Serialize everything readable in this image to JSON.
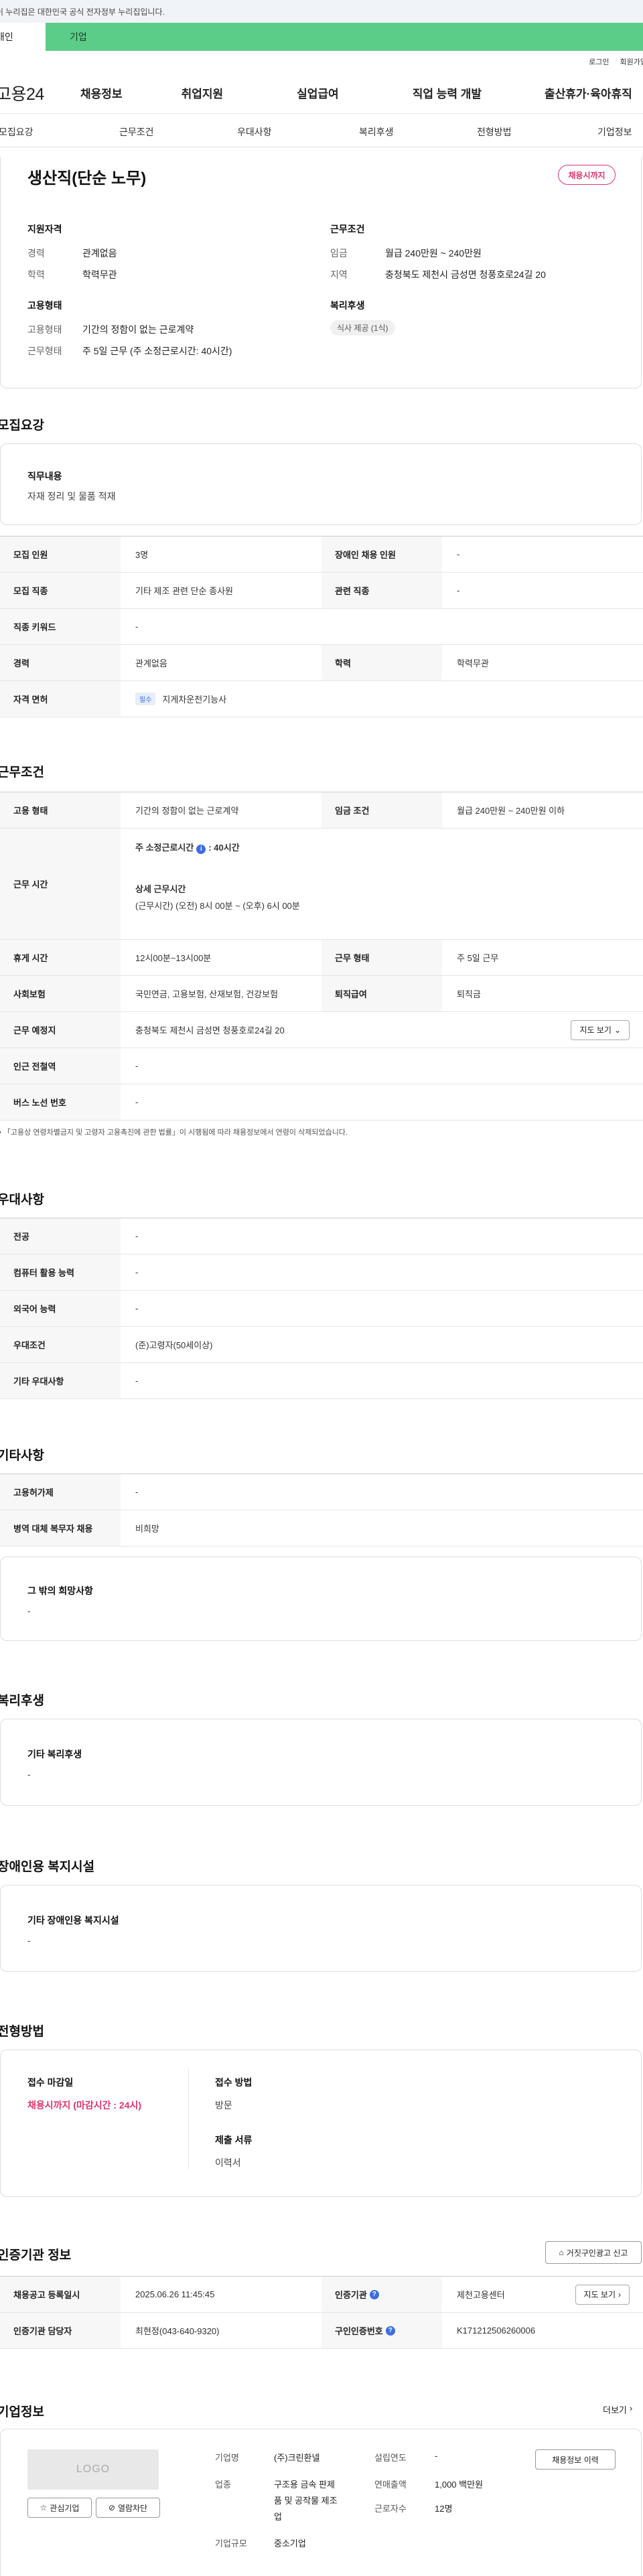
{
  "gov_banner": "이 누리집은 대한민국 공식 전자정부 누리집입니다.",
  "user_tabs": {
    "personal": "개인",
    "company": "기업"
  },
  "util": {
    "login": "로그인",
    "join": "회원가입"
  },
  "logo": "고용24",
  "gnb": [
    "채용정보",
    "취업지원",
    "실업급여",
    "직업 능력 개발",
    "출산휴가·육아휴직"
  ],
  "anchor_tabs": [
    "모집요강",
    "근무조건",
    "우대사항",
    "복리후생",
    "전형방법",
    "기업정보"
  ],
  "summary": {
    "title": "생산직(단순 노무)",
    "badge": "채용시까지",
    "qual_head": "지원자격",
    "career_k": "경력",
    "career_v": "관계없음",
    "edu_k": "학력",
    "edu_v": "학력무관",
    "emp_head": "고용형태",
    "emp_k": "고용형태",
    "emp_v": "기간의 정함이 없는 근로계약",
    "work_k": "근무형태",
    "work_v": "주 5일 근무 (주 소정근로시간: 40시간)",
    "cond_head": "근무조건",
    "wage_k": "임금",
    "wage_v": "월급 240만원 ~ 240만원",
    "region_k": "지역",
    "region_v": "충청북도 제천시 금성면 청풍호로24길 20",
    "welfare_head": "복리후생",
    "welfare_chip": "식사 제공 (1식)"
  },
  "recruit": {
    "title": "모집요강",
    "duty_head": "직무내용",
    "duty_v": "자재 정리 및 물품 적재",
    "rows": {
      "count_k": "모집 인원",
      "count_v": "3명",
      "disabled_k": "장애인 채용 인원",
      "disabled_v": "-",
      "job_k": "모집 직종",
      "job_v": "기타 제조 관련 단순 종사원",
      "related_k": "관련 직종",
      "related_v": "-",
      "keyword_k": "직종 키워드",
      "keyword_v": "-",
      "career_k": "경력",
      "career_v": "관계없음",
      "edu_k": "학력",
      "edu_v": "학력무관",
      "license_k": "자격 면허",
      "license_tag": "필수",
      "license_v": "지게차운전기능사"
    }
  },
  "conditions": {
    "title": "근무조건",
    "emp_k": "고용 형태",
    "emp_v": "기간의 정함이 없는 근로계약",
    "wage_k": "임금 조건",
    "wage_v": "월급 240만원 ~ 240만원 이하",
    "hours_k": "근무 시간",
    "hours_l1a": "주 소정근로시간",
    "hours_l1b": ": 40시간",
    "hours_l2": "상세 근무시간",
    "hours_l3": "(근무시간) (오전) 8시 00분 ~ (오후) 6시 00분",
    "break_k": "휴게 시간",
    "break_v": "12시00분~13시00분",
    "type_k": "근무 형태",
    "type_v": "주 5일 근무",
    "ins_k": "사회보험",
    "ins_v": "국민연금, 고용보험, 산재보험, 건강보험",
    "pension_k": "퇴직급여",
    "pension_v": "퇴직금",
    "place_k": "근무 예정지",
    "place_v": "충청북도 제천시 금성면 청풍호로24길 20",
    "map_btn": "지도 보기",
    "station_k": "인근 전철역",
    "station_v": "-",
    "bus_k": "버스 노선 번호",
    "bus_v": "-",
    "note": "「고용상 연령차별금지 및 고령자 고용촉진에 관한 법률」이 시행됨에 따라 채용정보에서 연령이 삭제되었습니다."
  },
  "preferred": {
    "title": "우대사항",
    "major_k": "전공",
    "major_v": "-",
    "pc_k": "컴퓨터 활용 능력",
    "pc_v": "-",
    "lang_k": "외국어 능력",
    "lang_v": "-",
    "cond_k": "우대조건",
    "cond_v": "(준)고령자(50세이상)",
    "etc_k": "기타 우대사항",
    "etc_v": "-"
  },
  "others": {
    "title": "기타사항",
    "equip_k": "고용허가제",
    "equip_v": "-",
    "military_k": "병역 대체 복무자 채용",
    "military_v": "비희망",
    "wish_head": "그 밖의 희망사항",
    "wish_v": "-"
  },
  "welfare": {
    "title": "복리후생",
    "head": "기타 복리후생",
    "v": "-"
  },
  "facility": {
    "title": "장애인용 복지시설",
    "head": "기타 장애인용 복지시설",
    "v": "-"
  },
  "selection": {
    "title": "전형방법",
    "deadline_head": "접수 마감일",
    "deadline_v": "채용시까지 (마감시간 : 24시)",
    "method_head": "접수 방법",
    "method_v": "방문",
    "docs_head": "제출 서류",
    "docs_v": "이력서"
  },
  "agency": {
    "title": "인증기관 정보",
    "report_btn": "거짓구인광고 신고",
    "reg_k": "채용공고 등록일시",
    "reg_v": "2025.06.26 11:45:45",
    "org_k": "인증기관",
    "org_v": "제천고용센터",
    "map_btn": "지도 보기",
    "mgr_k": "인증기관 담당자",
    "mgr_v": "최현정(043-640-9320)",
    "no_k": "구인인증번호",
    "no_v": "K171212506260006"
  },
  "company": {
    "title": "기업정보",
    "more": "더보기",
    "logo_text": "LOGO",
    "fav_btn": "관심기업",
    "block_btn": "열람차단",
    "name_k": "기업명",
    "name_v": "(주)크린환넬",
    "ind_k": "업종",
    "ind_v1": "구조용 금속 판제",
    "ind_v2": "품 및 공작물 제조",
    "ind_v3": "업",
    "size_k": "기업규모",
    "size_v": "중소기업",
    "year_k": "설립연도",
    "year_v": "-",
    "sales_k": "연매출액",
    "sales_v": "1,000 백만원",
    "emp_k": "근로자수",
    "emp_v": "12명",
    "history_btn": "채용정보 이력"
  }
}
